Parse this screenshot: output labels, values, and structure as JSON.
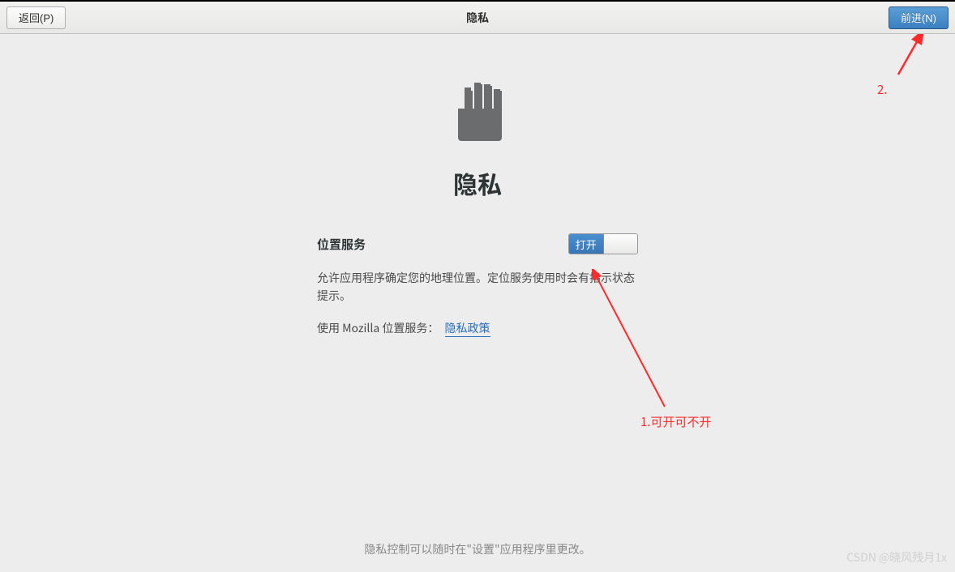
{
  "header": {
    "back_label": "返回(P)",
    "title": "隐私",
    "next_label": "前进(N)"
  },
  "main": {
    "heading": "隐私",
    "location": {
      "label": "位置服务",
      "toggle_on_text": "打开",
      "description": "允许应用程序确定您的地理位置。定位服务使用时会有指示状态提示。",
      "policy_prefix": "使用  Mozilla 位置服务：",
      "policy_link": "隐私政策"
    },
    "footer": "隐私控制可以随时在\"设置\"应用程序里更改。"
  },
  "annotations": {
    "step1": "1.可开可不开",
    "step2": "2."
  },
  "watermark": "CSDN @晓风残月1x"
}
